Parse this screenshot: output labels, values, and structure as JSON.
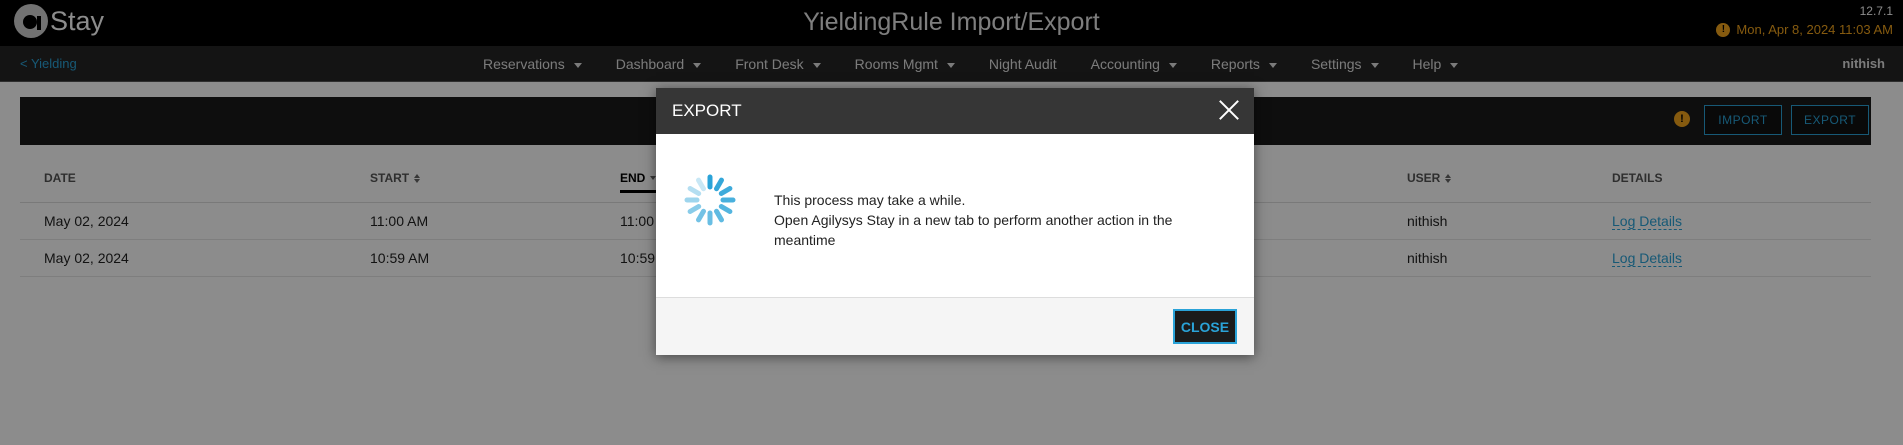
{
  "app": {
    "logo_text": "Stay",
    "title": "YieldingRule Import/Export",
    "version": "12.7.1",
    "datetime": "Mon, Apr 8, 2024 11:03 AM",
    "alert_glyph": "!"
  },
  "nav": {
    "back_label": "< Yielding",
    "items": [
      {
        "label": "Reservations"
      },
      {
        "label": "Dashboard"
      },
      {
        "label": "Front Desk"
      },
      {
        "label": "Rooms Mgmt"
      },
      {
        "label": "Night Audit"
      },
      {
        "label": "Accounting"
      },
      {
        "label": "Reports"
      },
      {
        "label": "Settings"
      },
      {
        "label": "Help"
      }
    ],
    "user": "nithish"
  },
  "toolbar": {
    "info_glyph": "!",
    "import_label": "IMPORT",
    "export_label": "EXPORT"
  },
  "table": {
    "columns": {
      "date": "DATE",
      "start": "START",
      "end": "END",
      "user": "USER",
      "details": "DETAILS"
    },
    "rows": [
      {
        "date": "May 02, 2024",
        "start": "11:00 AM",
        "end": "11:00",
        "user": "nithish",
        "details": "Log Details"
      },
      {
        "date": "May 02, 2024",
        "start": "10:59 AM",
        "end": "10:59",
        "user": "nithish",
        "details": "Log Details"
      }
    ]
  },
  "modal": {
    "title": "EXPORT",
    "line1": "This process may take a while.",
    "line2": "Open Agilysys Stay in a new tab to perform another action in the meantime",
    "close_label": "CLOSE"
  },
  "colors": {
    "accent": "#2aa3d8",
    "warning": "#f2a51d",
    "header_bg": "#000000",
    "nav_bg": "#262626"
  }
}
